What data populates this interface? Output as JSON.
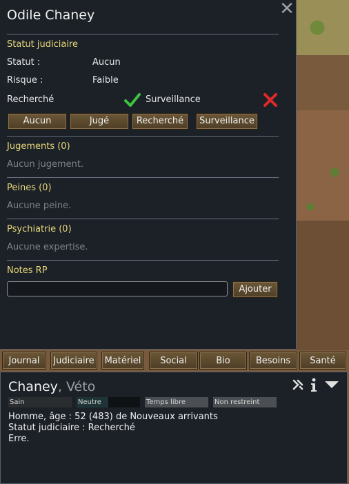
{
  "window": {
    "title": "Odile Chaney"
  },
  "legal": {
    "section_title": "Statut judiciaire",
    "status_label": "Statut :",
    "status_value": "Aucun",
    "risk_label": "Risque :",
    "risk_value": "Faible",
    "wanted_label": "Recherché",
    "surveillance_label": "Surveillance",
    "buttons": [
      "Aucun",
      "Jugé",
      "Recherché",
      "Surveillance"
    ]
  },
  "judgments": {
    "title": "Jugements (0)",
    "empty": "Aucun jugement."
  },
  "sentences": {
    "title": "Peines (0)",
    "empty": "Aucune peine."
  },
  "psychiatry": {
    "title": "Psychiatrie (0)",
    "empty": "Aucune expertise."
  },
  "notes": {
    "title": "Notes RP",
    "input_value": "",
    "add_label": "Ajouter"
  },
  "tabs": [
    "Journal",
    "Judiciaire",
    "Matériel",
    "Social",
    "Bio",
    "Besoins",
    "Santé"
  ],
  "pawn": {
    "last_name": "Chaney",
    "nickname": ", Véto",
    "bars": [
      "Sain",
      "Neutre",
      "Temps libre",
      "Non restreint"
    ],
    "line1": "Homme, âge : 52 (483) de Nouveaux arrivants",
    "line2": "Statut judiciaire : Recherché",
    "line3": "Erre."
  },
  "colors": {
    "panel_bg": "#1c2128",
    "section_title": "#e8d87a",
    "check": "#3cc43c",
    "cross": "#e02828",
    "button": "#5e4b2f"
  },
  "icons": [
    "close-icon",
    "check-icon",
    "cross-icon",
    "draft-icon",
    "info-icon",
    "collapse-icon"
  ]
}
